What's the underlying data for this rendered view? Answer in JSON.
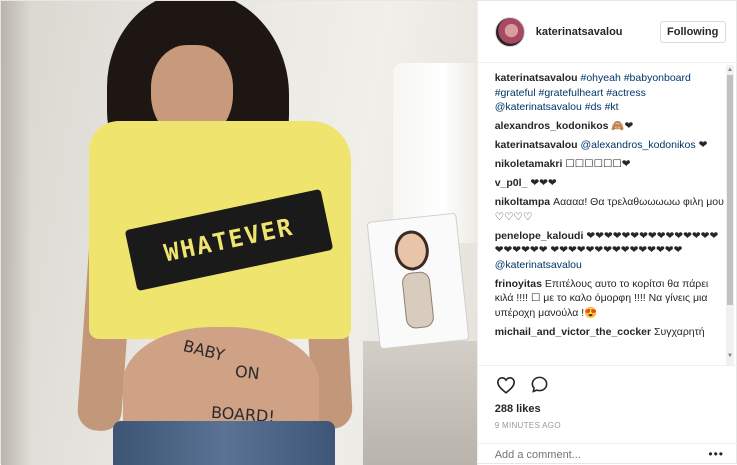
{
  "post": {
    "username": "katerinatsavalou",
    "follow_label": "Following",
    "photo_text": {
      "shirt": "WHATEVER",
      "belly_line1": "BABY",
      "belly_line2": "ON",
      "belly_line3": "BOARD!"
    },
    "comments": [
      {
        "user": "katerinatsavalou",
        "text": "",
        "tags": "#ohyeah #babyonboard #grateful #gratefulheart #actress @katerinatsavalou #ds #kt"
      },
      {
        "user": "alexandros_kodonikos",
        "text": "🙈❤",
        "tags": ""
      },
      {
        "user": "katerinatsavalou",
        "text": "❤",
        "tags": "@alexandros_kodonikos"
      },
      {
        "user": "nikoletamakri",
        "text": "☐☐☐☐☐☐❤",
        "tags": ""
      },
      {
        "user": "v_p0l_",
        "text": "❤❤❤",
        "tags": ""
      },
      {
        "user": "nikoltampa",
        "text": "Ααααα! Θα τρελαθωωωωω φιλη μου ♡♡♡♡",
        "tags": ""
      },
      {
        "user": "penelope_kaloudi",
        "text": "❤❤❤❤❤❤❤❤❤❤❤❤❤❤❤❤❤❤❤❤❤ ❤❤❤❤❤❤❤❤❤❤❤❤❤❤❤",
        "tags": "@katerinatsavalou"
      },
      {
        "user": "frinoyitas",
        "text": "Επιτέλους αυτο το κορίτσι θα πάρει κιλά !!!! ☐ με το καλο όμορφη !!!! Να γίνεις μια υπέροχη μανούλα !😍",
        "tags": ""
      },
      {
        "user": "michail_and_victor_the_cocker",
        "text": "Συγχαρητή",
        "tags": ""
      }
    ],
    "likes": "288 likes",
    "timestamp": "9 MINUTES AGO",
    "add_comment_placeholder": "Add a comment...",
    "icons": {
      "like": "heart-icon",
      "comment": "speech-bubble-icon",
      "more": "more-options-icon"
    }
  }
}
